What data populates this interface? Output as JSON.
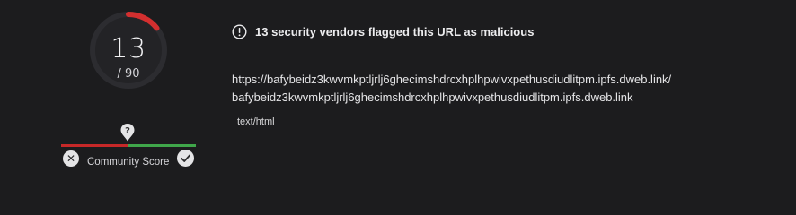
{
  "detection": {
    "count": "13",
    "total": "/ 90",
    "fraction": 0.1444,
    "ring_color": "#d32f2f",
    "track_color": "#2a2a2d"
  },
  "community": {
    "label": "Community Score",
    "marker_icon": "question-pin-icon",
    "negative_icon": "x-icon",
    "positive_icon": "check-icon",
    "negative_color": "#c62828",
    "positive_color": "#3fa64a"
  },
  "alert": {
    "icon": "info-circle-icon",
    "text": "13 security vendors flagged this URL as malicious"
  },
  "url": {
    "line1": "https://bafybeidz3kwvmkptljrlj6ghecimshdrcxhplhpwivxpethusdiudlitpm.ipfs.dweb.link/",
    "line2": "bafybeidz3kwvmkptljrlj6ghecimshdrcxhplhpwivxpethusdiudlitpm.ipfs.dweb.link"
  },
  "content_type": "text/html"
}
